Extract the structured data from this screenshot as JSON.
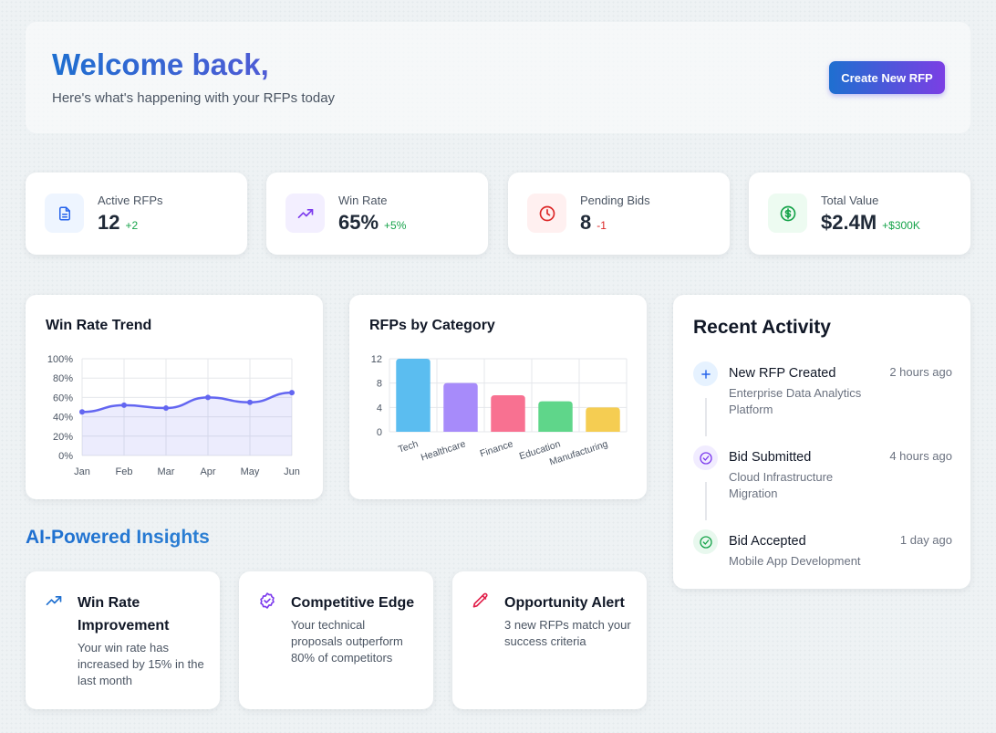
{
  "header": {
    "title": "Welcome back,",
    "subtitle": "Here's what's happening with your RFPs today",
    "cta_label": "Create New RFP"
  },
  "stats": [
    {
      "label": "Active RFPs",
      "value": "12",
      "delta": "+2",
      "trend": "up",
      "icon": "document-icon",
      "color": "#2563eb"
    },
    {
      "label": "Win Rate",
      "value": "65%",
      "delta": "+5%",
      "trend": "up",
      "icon": "trending-up-icon",
      "color": "#7c3aed"
    },
    {
      "label": "Pending Bids",
      "value": "8",
      "delta": "-1",
      "trend": "down",
      "icon": "clock-icon",
      "color": "#dc2626"
    },
    {
      "label": "Total Value",
      "value": "$2.4M",
      "delta": "+$300K",
      "trend": "up",
      "icon": "dollar-icon",
      "color": "#16a34a"
    }
  ],
  "win_rate_chart": {
    "title": "Win Rate Trend"
  },
  "category_chart": {
    "title": "RFPs by Category"
  },
  "chart_data": [
    {
      "type": "area",
      "title": "Win Rate Trend",
      "x": [
        "Jan",
        "Feb",
        "Mar",
        "Apr",
        "May",
        "Jun"
      ],
      "y_ticks": [
        "0%",
        "20%",
        "40%",
        "60%",
        "80%",
        "100%"
      ],
      "ylim": [
        0,
        100
      ],
      "series": [
        {
          "values": [
            45,
            52,
            49,
            60,
            55,
            65
          ],
          "color": "#6366f1"
        }
      ],
      "grid": true
    },
    {
      "type": "bar",
      "title": "RFPs by Category",
      "categories": [
        "Tech",
        "Healthcare",
        "Finance",
        "Education",
        "Manufacturing"
      ],
      "values": [
        12,
        8,
        6,
        5,
        4
      ],
      "colors": [
        "#5bbdf0",
        "#a78bfa",
        "#f87191",
        "#5fd68a",
        "#f5cd52"
      ],
      "y_ticks": [
        "0",
        "4",
        "8",
        "12"
      ],
      "ylim": [
        0,
        12
      ],
      "grid": true
    }
  ],
  "activity": {
    "title": "Recent Activity",
    "items": [
      {
        "title": "New RFP Created",
        "subtitle": "Enterprise Data Analytics Platform",
        "time": "2 hours ago",
        "icon": "plus-icon"
      },
      {
        "title": "Bid Submitted",
        "subtitle": "Cloud Infrastructure Migration",
        "time": "4 hours ago",
        "icon": "check-circle-icon"
      },
      {
        "title": "Bid Accepted",
        "subtitle": "Mobile App Development",
        "time": "1 day ago",
        "icon": "check-circle-icon"
      }
    ]
  },
  "insights": {
    "title": "AI-Powered Insights",
    "items": [
      {
        "title": "Win Rate Improvement",
        "description": "Your win rate has increased by 15% in the last month",
        "icon": "trending-up-icon"
      },
      {
        "title": "Competitive Edge",
        "description": "Your technical proposals outperform 80% of competitors",
        "icon": "badge-check-icon"
      },
      {
        "title": "Opportunity Alert",
        "description": "3 new RFPs match your success criteria",
        "icon": "pencil-icon"
      }
    ]
  }
}
